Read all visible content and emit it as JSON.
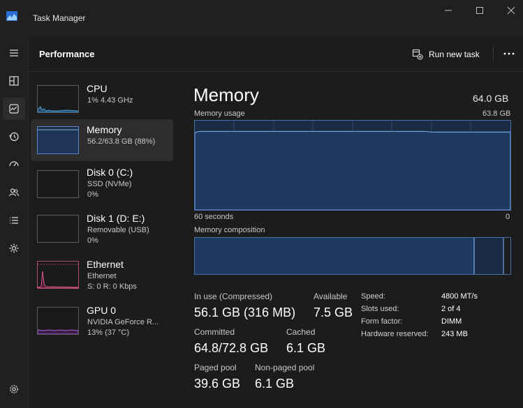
{
  "window": {
    "title": "Task Manager"
  },
  "header": {
    "title": "Performance",
    "run_task_label": "Run new task"
  },
  "sidebar_items": [
    {
      "name": "CPU",
      "line1": "1%  4.43 GHz",
      "line2": ""
    },
    {
      "name": "Memory",
      "line1": "56.2/63.8 GB (88%)",
      "line2": ""
    },
    {
      "name": "Disk 0 (C:)",
      "line1": "SSD (NVMe)",
      "line2": "0%"
    },
    {
      "name": "Disk 1 (D: E:)",
      "line1": "Removable (USB)",
      "line2": "0%"
    },
    {
      "name": "Ethernet",
      "line1": "Ethernet",
      "line2": "S: 0  R: 0 Kbps"
    },
    {
      "name": "GPU 0",
      "line1": "NVIDIA GeForce R...",
      "line2": "13%  (37 °C)"
    }
  ],
  "memory": {
    "title": "Memory",
    "total": "64.0 GB",
    "usage_label": "Memory usage",
    "usage_max": "63.8 GB",
    "time_left": "60 seconds",
    "time_right": "0",
    "composition_label": "Memory composition",
    "usage_fraction": 0.88,
    "stats": {
      "in_use_label": "In use (Compressed)",
      "in_use_value": "56.1 GB (316 MB)",
      "available_label": "Available",
      "available_value": "7.5 GB",
      "committed_label": "Committed",
      "committed_value": "64.8/72.8 GB",
      "cached_label": "Cached",
      "cached_value": "6.1 GB",
      "paged_label": "Paged pool",
      "paged_value": "39.6 GB",
      "nonpaged_label": "Non-paged pool",
      "nonpaged_value": "6.1 GB"
    },
    "details": [
      {
        "label": "Speed:",
        "value": "4800 MT/s"
      },
      {
        "label": "Slots used:",
        "value": "2 of 4"
      },
      {
        "label": "Form factor:",
        "value": "DIMM"
      },
      {
        "label": "Hardware reserved:",
        "value": "243 MB"
      }
    ]
  },
  "colors": {
    "accent": "#60a5fa",
    "memory_fill": "#1b2b44",
    "ethernet": "#d9558c",
    "gpu": "#b05fd6"
  },
  "nav_icons": [
    "hamburger-icon",
    "processes-icon",
    "performance-icon",
    "app-history-icon",
    "startup-apps-icon",
    "users-icon",
    "details-icon",
    "services-icon",
    "settings-icon"
  ]
}
